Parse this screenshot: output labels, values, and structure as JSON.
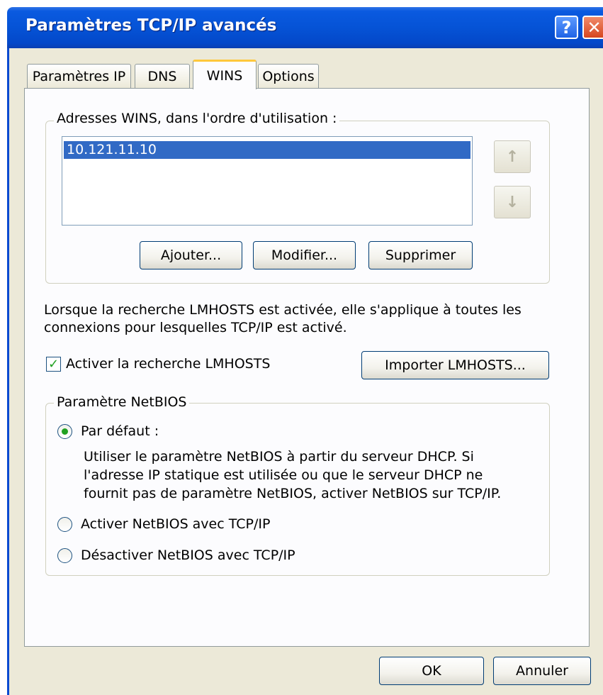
{
  "window": {
    "title": "Paramètres TCP/IP avancés",
    "help_glyph": "?",
    "close_glyph": "✕"
  },
  "tabs": [
    {
      "label": "Paramètres IP"
    },
    {
      "label": "DNS"
    },
    {
      "label": "WINS",
      "selected": true
    },
    {
      "label": "Options"
    }
  ],
  "wins": {
    "group_label": "Adresses WINS, dans l'ordre d'utilisation :",
    "addresses": [
      "10.121.11.10"
    ],
    "up_glyph": "↑",
    "down_glyph": "↓",
    "add_label": "Ajouter...",
    "edit_label": "Modifier...",
    "delete_label": "Supprimer"
  },
  "lmhosts": {
    "description_line1": "Lorsque la recherche LMHOSTS est activée, elle s'applique à toutes les",
    "description_line2": "connexions pour lesquelles TCP/IP est activé.",
    "enable_label": "Activer la recherche LMHOSTS",
    "enabled": true,
    "import_label": "Importer LMHOSTS..."
  },
  "netbios": {
    "group_label": "Paramètre NetBIOS",
    "options": [
      {
        "label": "Par défaut :",
        "selected": true
      },
      {
        "label": "Activer NetBIOS avec TCP/IP",
        "selected": false
      },
      {
        "label": "Désactiver NetBIOS avec TCP/IP",
        "selected": false
      }
    ],
    "default_desc_line1": "Utiliser le paramètre NetBIOS à partir du serveur DHCP. Si",
    "default_desc_line2": "l'adresse IP statique est utilisée ou que le serveur DHCP ne",
    "default_desc_line3": "fournit pas de paramètre NetBIOS, activer NetBIOS sur TCP/IP."
  },
  "footer": {
    "ok_label": "OK",
    "cancel_label": "Annuler"
  },
  "colors": {
    "title_bar": "#0553d6",
    "dialog_face": "#ece9d8",
    "selection": "#316ac5",
    "check_green": "#21a121"
  }
}
